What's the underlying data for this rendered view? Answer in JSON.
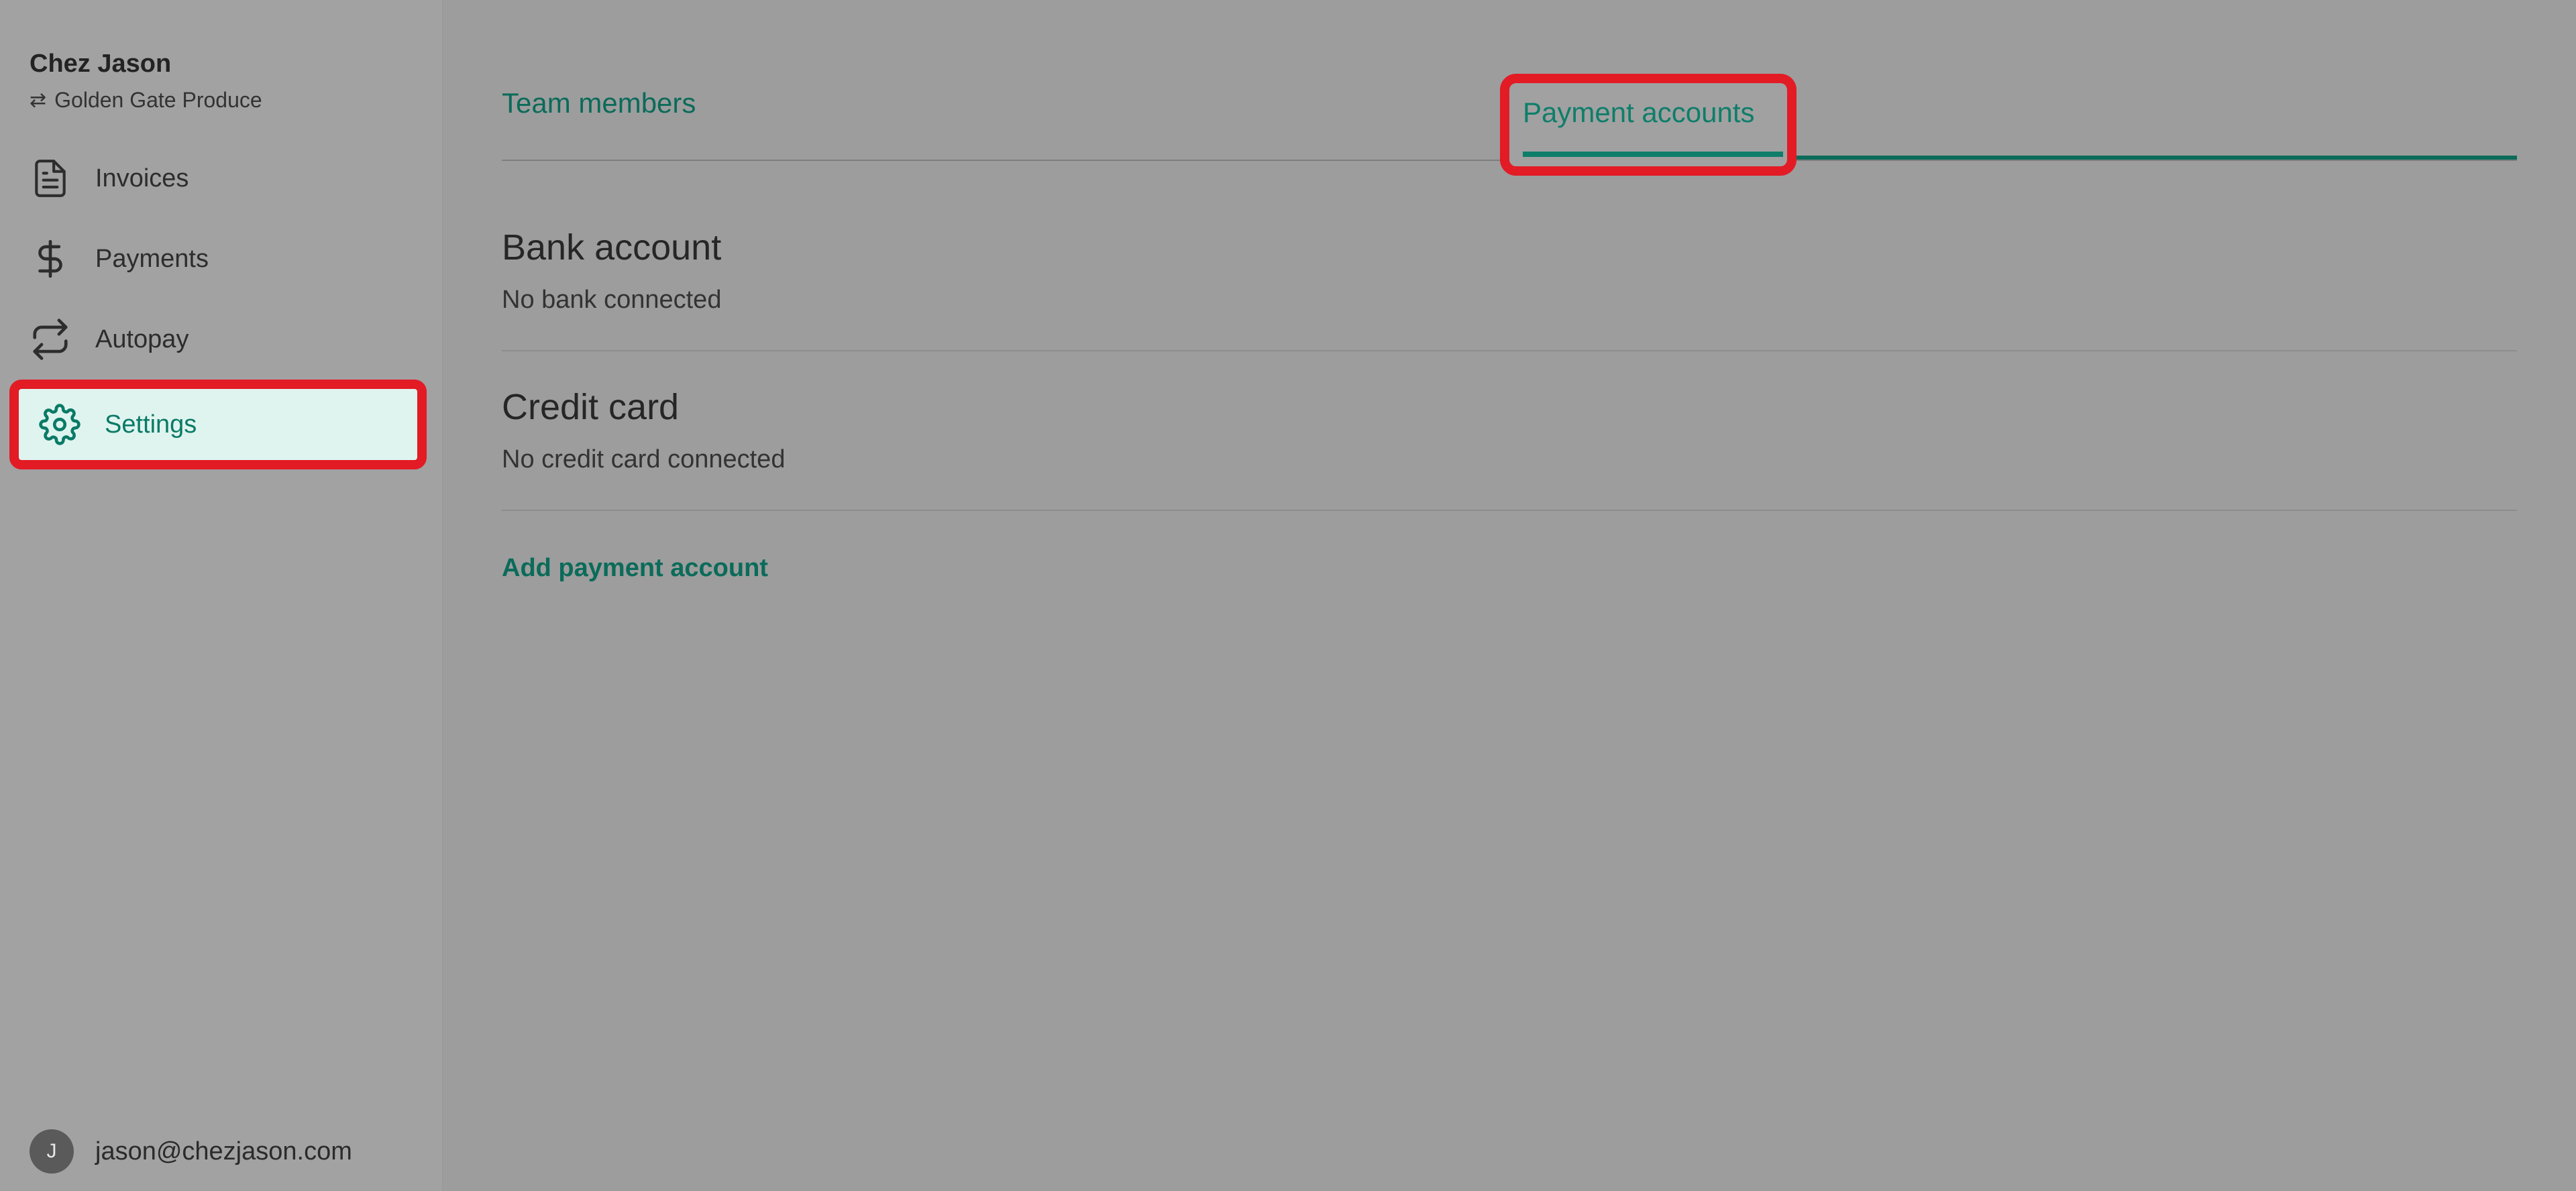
{
  "org": {
    "name": "Chez Jason",
    "swap_glyph": "⇄",
    "vendor": "Golden Gate Produce"
  },
  "nav": {
    "items": [
      {
        "label": "Invoices",
        "icon": "document-icon"
      },
      {
        "label": "Payments",
        "icon": "dollar-icon"
      },
      {
        "label": "Autopay",
        "icon": "repeat-icon"
      },
      {
        "label": "Settings",
        "icon": "gear-icon",
        "active": true
      }
    ]
  },
  "user": {
    "initial": "J",
    "email": "jason@chezjason.com"
  },
  "tabs": [
    {
      "label": "Team members"
    },
    {
      "label": "Payment accounts",
      "active": true
    }
  ],
  "sections": {
    "bank": {
      "title": "Bank account",
      "status": "No bank connected"
    },
    "card": {
      "title": "Credit card",
      "status": "No credit card connected"
    }
  },
  "actions": {
    "add_payment_account": "Add payment account"
  },
  "colors": {
    "accent": "#0b6b5a",
    "highlight": "#e21b25",
    "active_bg": "#dff4ef"
  }
}
